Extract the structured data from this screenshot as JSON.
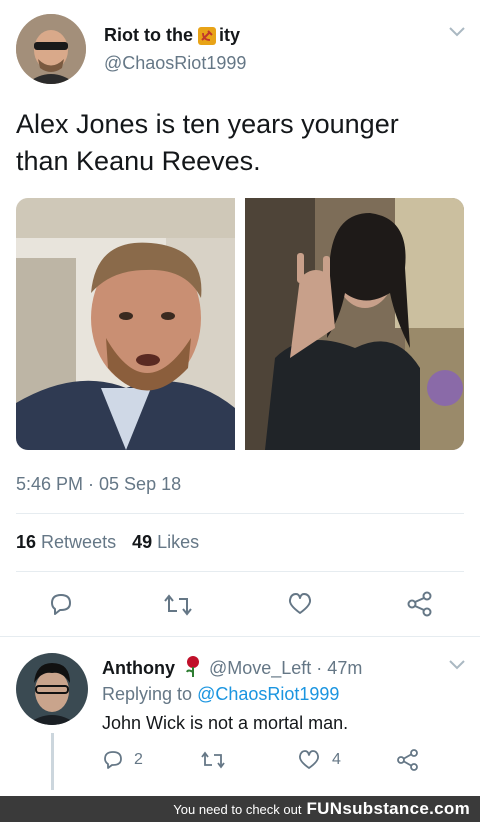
{
  "tweet": {
    "display_name": "Riot to the",
    "display_name_suffix": "ity",
    "handle": "@ChaosRiot1999",
    "text": "Alex Jones is ten years younger than  Keanu Reeves.",
    "timestamp": "5:46 PM · 05 Sep 18",
    "retweets_count": "16",
    "retweets_label": "Retweets",
    "likes_count": "49",
    "likes_label": "Likes"
  },
  "reply": {
    "display_name": "Anthony",
    "handle_time": "@Move_Left · 47m",
    "replying_prefix": "Replying to",
    "replying_to": "@ChaosRiot1999",
    "text": "John Wick is not a mortal man.",
    "reply_count": "2",
    "like_count": "4"
  },
  "footer": {
    "prefix": "You need to check out",
    "brand": "FUNsubstance.com"
  },
  "colors": {
    "link": "#1b95e0",
    "secondary_text": "#657786",
    "divider": "#e6ecf0"
  }
}
